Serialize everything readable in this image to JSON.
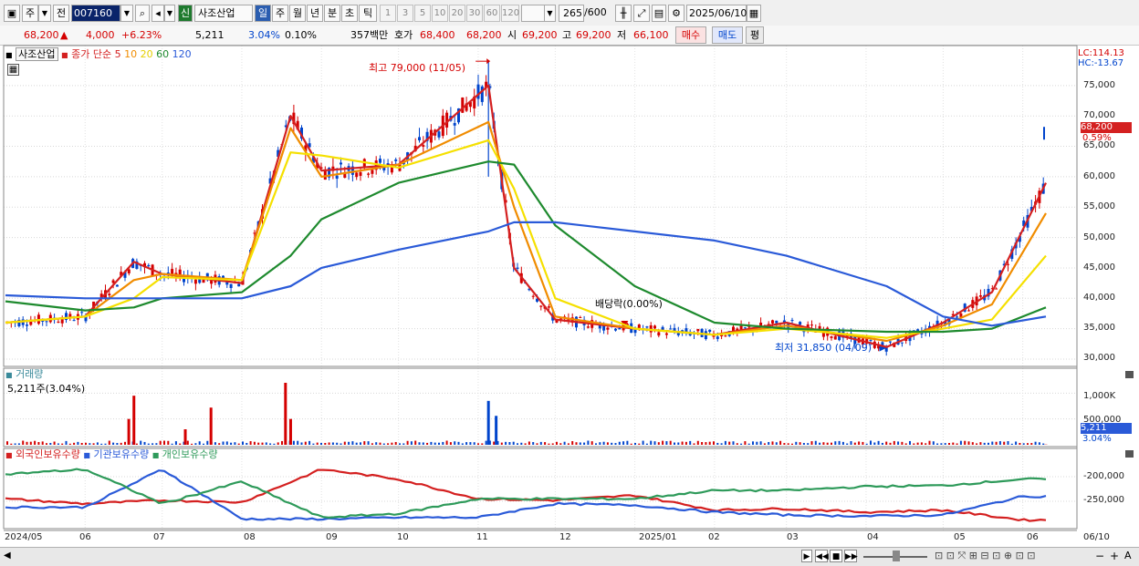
{
  "toolbar": {
    "period_main": "주",
    "prev_label": "전",
    "stock_code": "007160",
    "new_badge": "신",
    "stock_name": "사조산업",
    "periods": [
      "일",
      "주",
      "월",
      "년",
      "분",
      "초",
      "틱"
    ],
    "intervals": [
      "1",
      "3",
      "5",
      "10",
      "20",
      "30",
      "60",
      "120"
    ],
    "bars_shown": "265",
    "bars_total": "/600",
    "date": "2025/06/10"
  },
  "quote": {
    "price": "68,200",
    "arrow": "▲",
    "change": "4,000",
    "change_pct": "+6.23%",
    "volume": "5,211",
    "volume_pct": "3.04%",
    "turnover_pct": "0.10%",
    "value": "357백만",
    "ask_label": "호가",
    "ask1": "68,400",
    "ask2": "68,200",
    "open_label": "시",
    "open": "69,200",
    "high_label": "고",
    "high": "69,200",
    "low_label": "저",
    "low": "66,100",
    "buy_label": "매수",
    "sell_label": "매도",
    "eval_label": "평"
  },
  "price_panel": {
    "name_tag": "사조산업",
    "ma_label": "종가 단순",
    "ma_periods": [
      "5",
      "10",
      "20",
      "60",
      "120"
    ],
    "lc": "LC:114.13",
    "hc": "HC:-13.67",
    "last_price_tag": "68,200",
    "last_pct_tag": "0.59%",
    "max_annotation": "최고 79,000 (11/05)",
    "min_annotation": "최저 31,850 (04/09)",
    "dividend_annotation": "배당락(0.00%)",
    "y_ticks": [
      "75,000",
      "70,000",
      "65,000",
      "60,000",
      "55,000",
      "50,000",
      "45,000",
      "40,000",
      "35,000",
      "30,000"
    ]
  },
  "volume_panel": {
    "title": "거래량",
    "current": "5,211주(3.04%)",
    "y_ticks": [
      "1,000K",
      "500,000"
    ],
    "tag_value": "5,211",
    "tag_pct": "3.04%"
  },
  "holdings_panel": {
    "series": [
      "외국인보유수량",
      "기관보유수량",
      "개인보유수량"
    ],
    "y_ticks": [
      "-200,000",
      "-250,000"
    ]
  },
  "x_ticks": [
    "2024/05",
    "06",
    "07",
    "08",
    "09",
    "10",
    "11",
    "12",
    "2025/01",
    "02",
    "03",
    "04",
    "05",
    "06",
    "06/10"
  ],
  "colors": {
    "up": "#d40000",
    "down": "#0044cc",
    "ma5": "#d42020",
    "ma10": "#f08c00",
    "ma20": "#f5e000",
    "ma60": "#1e8a2e",
    "ma120": "#2a5ad8",
    "foreign": "#d42020",
    "institution": "#2a5ad8",
    "individual": "#2e9a5a"
  },
  "chart_data": [
    {
      "type": "line",
      "title": "사조산업",
      "xlabel": "",
      "ylabel": "",
      "ylim": [
        30000,
        80000
      ],
      "x": [
        "2024/05",
        "2024/06",
        "2024/06/20",
        "2024/07",
        "2024/08",
        "2024/08/20",
        "2024/09",
        "2024/10",
        "2024/11/05",
        "2024/11/15",
        "2024/12",
        "2025/01",
        "2025/02",
        "2025/03",
        "2025/04/09",
        "2025/05",
        "2025/05/20",
        "2025/06/10"
      ],
      "series": [
        {
          "name": "5",
          "values": [
            36000,
            37000,
            46000,
            44000,
            42500,
            70000,
            61000,
            62000,
            75000,
            45000,
            36500,
            35000,
            34000,
            36000,
            32000,
            36000,
            41000,
            59000
          ]
        },
        {
          "name": "10",
          "values": [
            36000,
            37000,
            43000,
            44000,
            43000,
            68000,
            60000,
            62000,
            69000,
            55000,
            37000,
            35000,
            34000,
            35500,
            33000,
            35500,
            39000,
            54000
          ]
        },
        {
          "name": "20",
          "values": [
            36000,
            37000,
            40000,
            43500,
            43000,
            64000,
            63500,
            61500,
            66000,
            58000,
            40000,
            35000,
            34000,
            35000,
            33500,
            35000,
            36500,
            47000
          ]
        },
        {
          "name": "60",
          "values": [
            39500,
            38000,
            38500,
            40000,
            41000,
            47000,
            53000,
            59000,
            62500,
            62000,
            52000,
            42000,
            36000,
            35000,
            34500,
            34500,
            35000,
            38500
          ]
        },
        {
          "name": "120",
          "values": [
            40500,
            40000,
            40000,
            40000,
            40000,
            42000,
            45000,
            48000,
            51000,
            52500,
            52500,
            51000,
            49500,
            47000,
            42000,
            37000,
            35500,
            37000
          ]
        }
      ],
      "last_close": 68200,
      "high": {
        "date": "11/05",
        "value": 79000
      },
      "low": {
        "date": "04/09",
        "value": 31850
      }
    },
    {
      "type": "bar",
      "title": "거래량",
      "ylim": [
        0,
        1200000
      ],
      "categories": [
        "2024/06/18",
        "2024/06/20",
        "2024/07/10",
        "2024/07/20",
        "2024/08/18",
        "2024/08/20",
        "2024/11/05",
        "2024/11/08",
        "2025/06/10"
      ],
      "values": [
        500000,
        950000,
        300000,
        720000,
        1200000,
        500000,
        850000,
        560000,
        5211
      ]
    },
    {
      "type": "line",
      "title": "보유수량",
      "x": [
        "2024/05",
        "2024/06",
        "2024/07",
        "2024/08",
        "2024/09",
        "2024/10",
        "2024/11",
        "2024/12",
        "2025/01",
        "2025/02",
        "2025/03",
        "2025/04",
        "2025/05",
        "2025/06"
      ],
      "series": [
        {
          "name": "외국인보유수량",
          "values": [
            -245000,
            -255000,
            -248000,
            -252000,
            -185000,
            -205000,
            -245000,
            -248000,
            -238000,
            -268000,
            -265000,
            -272000,
            -268000,
            -288000
          ]
        },
        {
          "name": "기관보유수량",
          "values": [
            -262000,
            -262000,
            -185000,
            -286000,
            -286000,
            -283000,
            -283000,
            -255000,
            -258000,
            -272000,
            -278000,
            -280000,
            -278000,
            -240000
          ]
        },
        {
          "name": "개인보유수량",
          "values": [
            -195000,
            -185000,
            -255000,
            -210000,
            -283000,
            -275000,
            -245000,
            -245000,
            -245000,
            -228000,
            -228000,
            -220000,
            -218000,
            -205000
          ]
        }
      ]
    }
  ]
}
